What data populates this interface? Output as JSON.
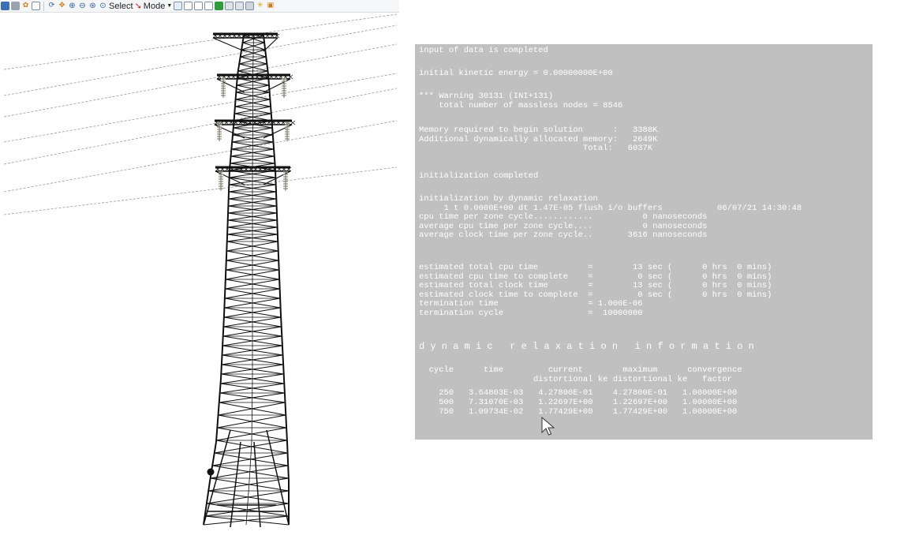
{
  "toolbar": {
    "select_label": "Select",
    "mode_label": "Mode",
    "icons": [
      "cube-icon",
      "shade-icon",
      "gear-icon",
      "grid-icon",
      "rotate-icon",
      "pan-icon",
      "zoom-in-icon",
      "zoom-out-icon",
      "zoom-window-icon",
      "zoom-fit-icon",
      "select-cursor-icon",
      "view-icon",
      "view-front-icon",
      "view-back-icon",
      "view-side-icon",
      "view-top-icon",
      "view-bottom-icon",
      "view-iso-icon",
      "light-icon",
      "snapshot-icon"
    ]
  },
  "viewport": {
    "content": "transmission-tower-model",
    "colors": {
      "background": "#ffffff",
      "tower": "#111111",
      "wires": "#9a9a9a",
      "insulators": "#a9a995"
    }
  },
  "console": {
    "background": "#c0c0c0",
    "text_color": "#ffffff",
    "lines": {
      "input_completed": "input of data is completed",
      "initial_ke": "initial kinetic energy = 0.00000000E+00",
      "warning": "*** Warning 30131 (INI+131)\n    total number of massless nodes = 8546",
      "memory": "Memory required to begin solution      :   3388K\nAdditional dynamically allocated memory:   2649K\n                                 Total:   6037K",
      "init_completed": "initialization completed",
      "relaxation": "initialization by dynamic relaxation\n     1 t 0.0000E+00 dt 1.47E-05 flush i/o buffers           06/07/21 14:30:48\ncpu time per zone cycle............          0 nanoseconds\naverage cpu time per zone cycle....          0 nanoseconds\naverage clock time per zone cycle..       3616 nanoseconds",
      "estimates": "estimated total cpu time          =        13 sec (      0 hrs  0 mins)\nestimated cpu time to complete    =         0 sec (      0 hrs  0 mins)\nestimated total clock time        =        13 sec (      0 hrs  0 mins)\nestimated clock time to complete  =         0 sec (      0 hrs  0 mins)\ntermination time                  = 1.000E-06\ntermination cycle                 =  10000000",
      "heading": "d y n a m i c   r e l a x a t i o n   i n f o r m a t i o n",
      "table_header": "  cycle      time         current        maximum      convergence\n                       distortional ke distortional ke   factor",
      "rows": [
        "    250   3.64803E-03   4.27800E-01    4.27800E-01   1.00000E+00",
        "    500   7.31070E-03   1.22697E+00    1.22697E+00   1.00000E+00",
        "    750   1.09734E-02   1.77429E+00    1.77429E+00   1.00000E+00"
      ]
    }
  }
}
